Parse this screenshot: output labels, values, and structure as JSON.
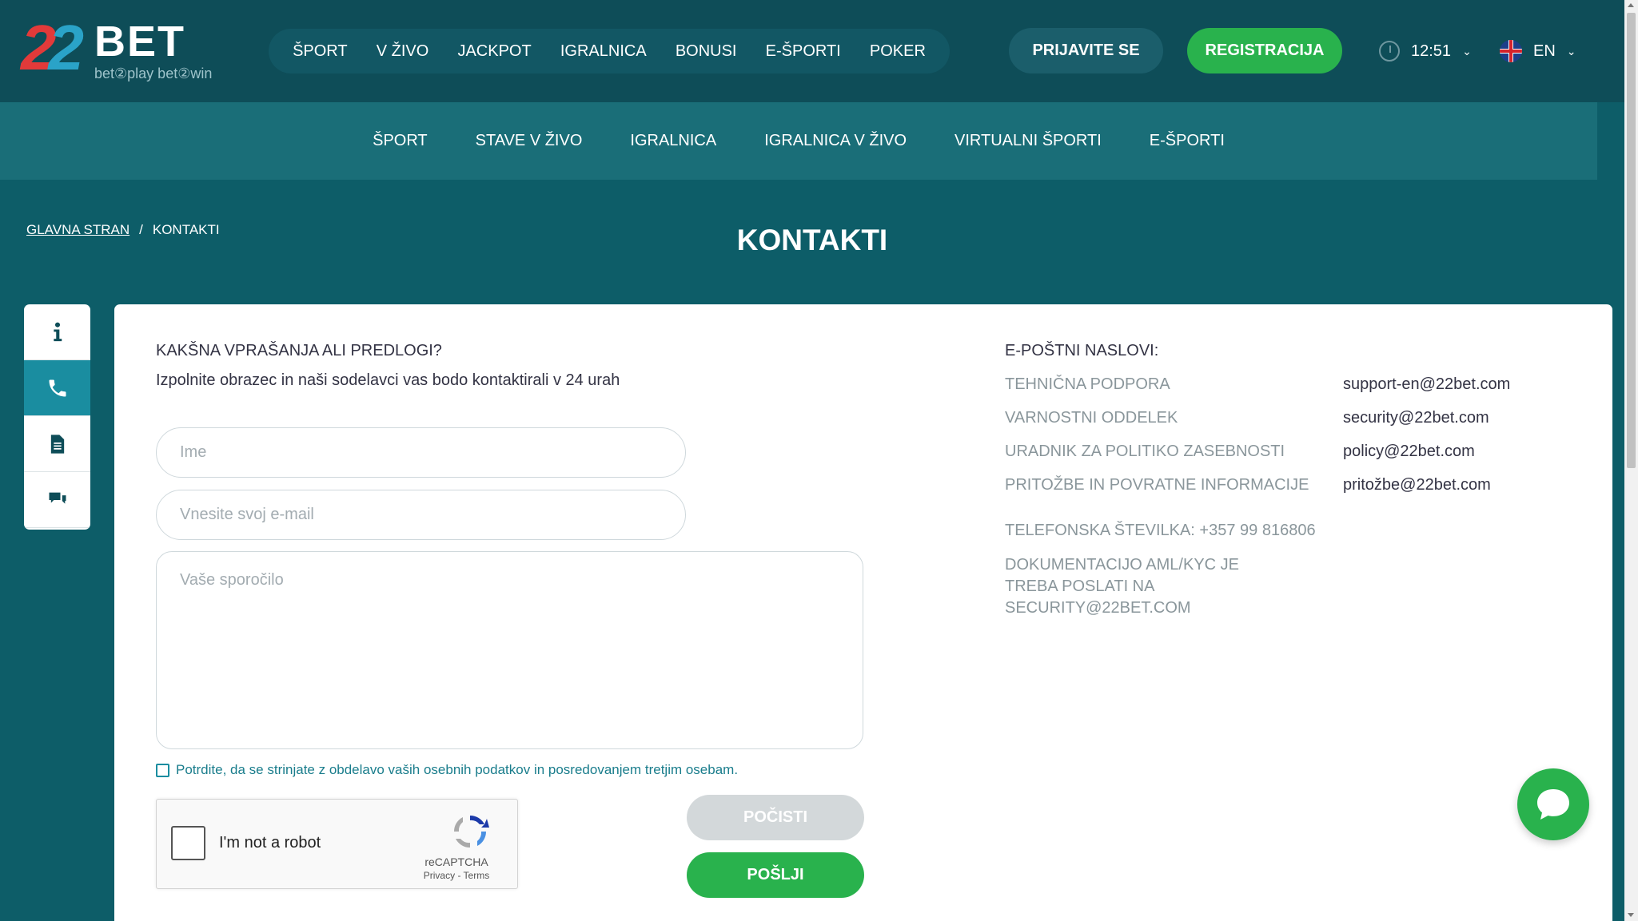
{
  "header": {
    "logo": {
      "number": "22",
      "brand": "BET",
      "tagline": "bet②play bet②win"
    },
    "nav": [
      "ŠPORT",
      "V ŽIVO",
      "JACKPOT",
      "IGRALNICA",
      "BONUSI",
      "E-ŠPORTI",
      "POKER"
    ],
    "login_label": "PRIJAVITE SE",
    "register_label": "REGISTRACIJA",
    "time": "12:51",
    "language": "EN",
    "icons": {
      "clock": "clock-icon",
      "flag": "uk-flag-icon",
      "chevron": "chevron-down-icon"
    }
  },
  "sub_nav": [
    "ŠPORT",
    "STAVE V ŽIVO",
    "IGRALNICA",
    "IGRALNICA V ŽIVO",
    "VIRTUALNI ŠPORTI",
    "E-ŠPORTI"
  ],
  "breadcrumb": {
    "home": "GLAVNA STRAN",
    "separator": "/",
    "current": "KONTAKTI"
  },
  "page_title": "KONTAKTI",
  "side_menu": [
    {
      "icon": "info-icon",
      "active": false
    },
    {
      "icon": "phone-icon",
      "active": true
    },
    {
      "icon": "document-icon",
      "active": false
    },
    {
      "icon": "chat-icon",
      "active": false
    }
  ],
  "form": {
    "question": "KAKŠNA VPRAŠANJA ALI PREDLOGI?",
    "subtitle": "Izpolnite obrazec in naši sodelavci vas bodo kontaktirali v 24 urah",
    "name_placeholder": "Ime",
    "email_placeholder": "Vnesite svoj e-mail",
    "message_placeholder": "Vaše sporočilo",
    "consent": "Potrdite, da se strinjate z obdelavo vaših osebnih podatkov in posredovanjem tretjim osebam.",
    "captcha": {
      "label": "I'm not a robot",
      "brand": "reCAPTCHA",
      "links": "Privacy - Terms"
    },
    "clear_label": "POČISTI",
    "send_label": "POŠLJI"
  },
  "contacts": {
    "title": "E-POŠTNI NASLOVI:",
    "rows": [
      {
        "label": "TEHNIČNA PODPORA",
        "email": "support-en@22bet.com"
      },
      {
        "label": "VARNOSTNI ODDELEK",
        "email": "security@22bet.com"
      },
      {
        "label": "URADNIK ZA POLITIKO ZASEBNOSTI",
        "email": "policy@22bet.com"
      },
      {
        "label": "PRITOŽBE IN POVRATNE INFORMACIJE",
        "email": "pritožbe@22bet.com"
      }
    ],
    "phone": "TELEFONSKA ŠTEVILKA: +357 99 816806",
    "aml": "DOKUMENTACIJO AML/KYC JE TREBA POSLATI NA SECURITY@22BET.COM"
  },
  "colors": {
    "header_bg": "#0e4d58",
    "page_bg": "#0d5d68",
    "accent_green": "#29b24d",
    "accent_teal": "#1a8da0"
  }
}
